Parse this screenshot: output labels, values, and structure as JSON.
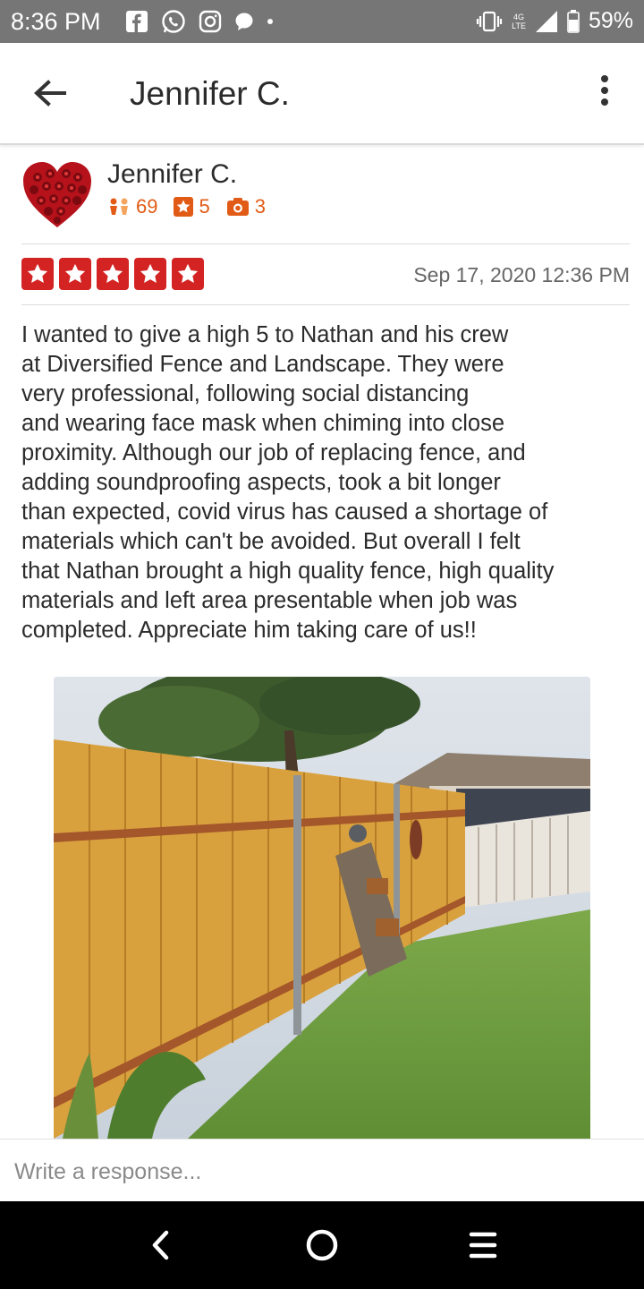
{
  "status_bar": {
    "time": "8:36 PM",
    "network": "4G",
    "network_sub": "LTE",
    "battery": "59%"
  },
  "app_bar": {
    "title": "Jennifer C."
  },
  "review": {
    "user_name": "Jennifer C.",
    "friends_count": "69",
    "reviews_count": "5",
    "photos_count": "3",
    "rating": 5,
    "date": "Sep 17, 2020 12:36 PM",
    "text": "I wanted to give a high 5 to Nathan and his crew\nat Diversified Fence and Landscape.  They were\nvery professional, following social distancing\nand wearing face mask when chiming into close\nproximity.   Although our job of replacing fence, and\nadding soundproofing aspects,  took a bit longer\nthan expected,  covid virus has caused a shortage of\nmaterials which can't be avoided.  But overall I felt\nthat Nathan brought a high quality fence, high quality\nmaterials and left area presentable when job was\ncompleted.  Appreciate him taking care of us!!"
  },
  "response": {
    "placeholder": "Write a response..."
  },
  "colors": {
    "accent": "#d32323",
    "stat_orange": "#e25b16"
  },
  "icons": [
    "facebook-icon",
    "whatsapp-icon",
    "instagram-icon",
    "messenger-icon",
    "vibrate-icon",
    "signal-icon",
    "battery-icon",
    "back-arrow-icon",
    "more-vert-icon",
    "friends-icon",
    "star-icon",
    "camera-icon",
    "nav-back-icon",
    "nav-home-icon",
    "nav-menu-icon"
  ]
}
